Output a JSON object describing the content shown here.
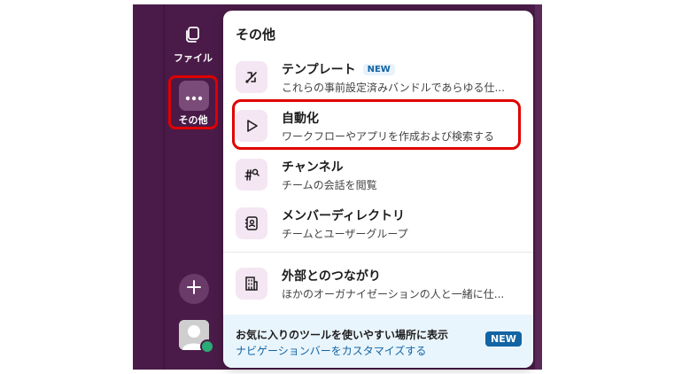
{
  "sidebar": {
    "files_label": "ファイル",
    "more_label": "その他"
  },
  "panel": {
    "title": "その他",
    "items": [
      {
        "title": "テンプレート",
        "badge": "NEW",
        "desc": "これらの事前設定済みバンドルであらゆる仕...",
        "icon": "template-icon"
      },
      {
        "title": "自動化",
        "desc": "ワークフローやアプリを作成および検索する",
        "icon": "play-icon"
      },
      {
        "title": "チャンネル",
        "desc": "チームの会話を閲覧",
        "icon": "channel-search-icon"
      },
      {
        "title": "メンバーディレクトリ",
        "desc": "チームとユーザーグループ",
        "icon": "contact-book-icon"
      },
      {
        "title": "外部とのつながり",
        "desc": "ほかのオーガナイゼーションの人と一緒に仕...",
        "icon": "building-icon"
      }
    ],
    "footer": {
      "title": "お気に入りのツールを使いやすい場所に表示",
      "link": "ナビゲーションバーをカスタマイズする",
      "badge": "NEW"
    }
  },
  "colors": {
    "sidebar_bg": "#4a1b48",
    "tile_bg": "#f4e6f3",
    "highlight": "#e00000",
    "link": "#1264a3",
    "footer_bg": "#e9f5fc"
  }
}
